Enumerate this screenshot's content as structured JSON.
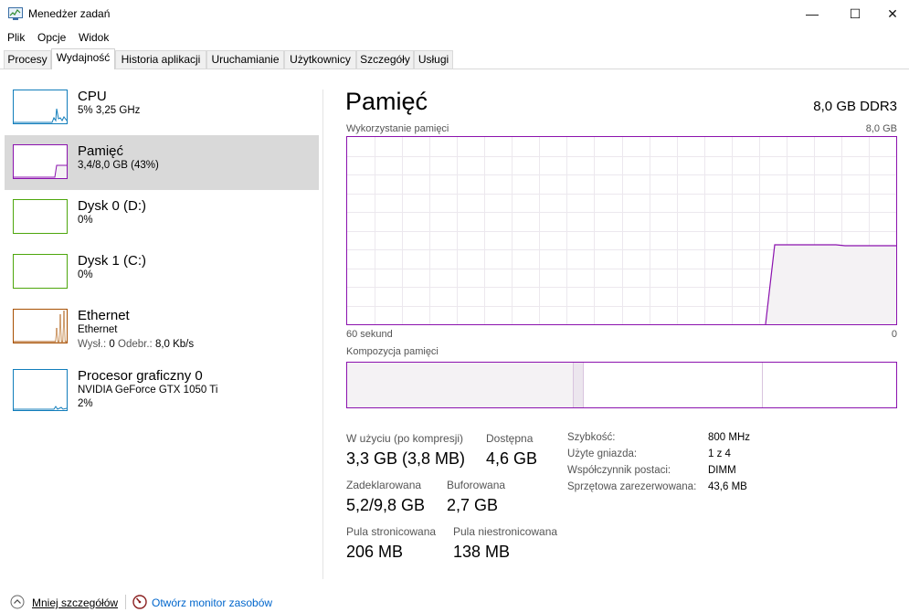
{
  "window": {
    "title": "Menedżer zadań",
    "controls": {
      "minimize": "—",
      "maximize": "☐",
      "close": "✕"
    }
  },
  "menu": [
    {
      "label": "Plik"
    },
    {
      "label": "Opcje"
    },
    {
      "label": "Widok"
    }
  ],
  "tabs": [
    {
      "label": "Procesy"
    },
    {
      "label": "Wydajność"
    },
    {
      "label": "Historia aplikacji"
    },
    {
      "label": "Uruchamianie"
    },
    {
      "label": "Użytkownicy"
    },
    {
      "label": "Szczegóły"
    },
    {
      "label": "Usługi"
    }
  ],
  "active_tab": "Wydajność",
  "sidebar": {
    "items": [
      {
        "title": "CPU",
        "line1": "5%  3,25 GHz",
        "line2": "",
        "color": "#117dbb"
      },
      {
        "title": "Pamięć",
        "line1": "3,4/8,0 GB (43%)",
        "line2": "",
        "color": "#8b12ae",
        "selected": true
      },
      {
        "title": "Dysk 0 (D:)",
        "line1": "0%",
        "line2": "",
        "color": "#4da60c"
      },
      {
        "title": "Dysk 1 (C:)",
        "line1": "0%",
        "line2": "",
        "color": "#4da60c"
      },
      {
        "title": "Ethernet",
        "line1": "Ethernet",
        "line2_a": "Wysł.:",
        "line2_b": "0",
        "line2_c": "Odebr.:",
        "line2_d": "8,0 Kb/s",
        "color": "#a74f01"
      },
      {
        "title": "Procesor graficzny 0",
        "line1": "NVIDIA GeForce GTX 1050 Ti",
        "line2": "2%",
        "color": "#117dbb"
      }
    ]
  },
  "memory": {
    "title": "Pamięć",
    "type": "8,0 GB DDR3",
    "usage_label": "Wykorzystanie pamięci",
    "usage_max": "8,0 GB",
    "time_left": "60 sekund",
    "time_right": "0",
    "composition_label": "Kompozycja pamięci",
    "usage_fraction": 0.43,
    "stats": {
      "in_use_label": "W użyciu (po kompresji)",
      "in_use_value": "3,3 GB (3,8 MB)",
      "available_label": "Dostępna",
      "available_value": "4,6 GB",
      "committed_label": "Zadeklarowana",
      "committed_value": "5,2/9,8 GB",
      "cached_label": "Buforowana",
      "cached_value": "2,7 GB",
      "paged_label": "Pula stronicowana",
      "paged_value": "206 MB",
      "nonpaged_label": "Pula niestronicowana",
      "nonpaged_value": "138 MB"
    },
    "details": [
      {
        "label": "Szybkość:",
        "value": "800 MHz"
      },
      {
        "label": "Użyte gniazda:",
        "value": "1 z 4"
      },
      {
        "label": "Współczynnik postaci:",
        "value": "DIMM"
      },
      {
        "label": "Sprzętowa zarezerwowana:",
        "value": "43,6 MB"
      }
    ]
  },
  "footer": {
    "less_details": "Mniej szczegółów",
    "open_monitor": "Otwórz monitor zasobów",
    "link_color": "#0066cc"
  }
}
